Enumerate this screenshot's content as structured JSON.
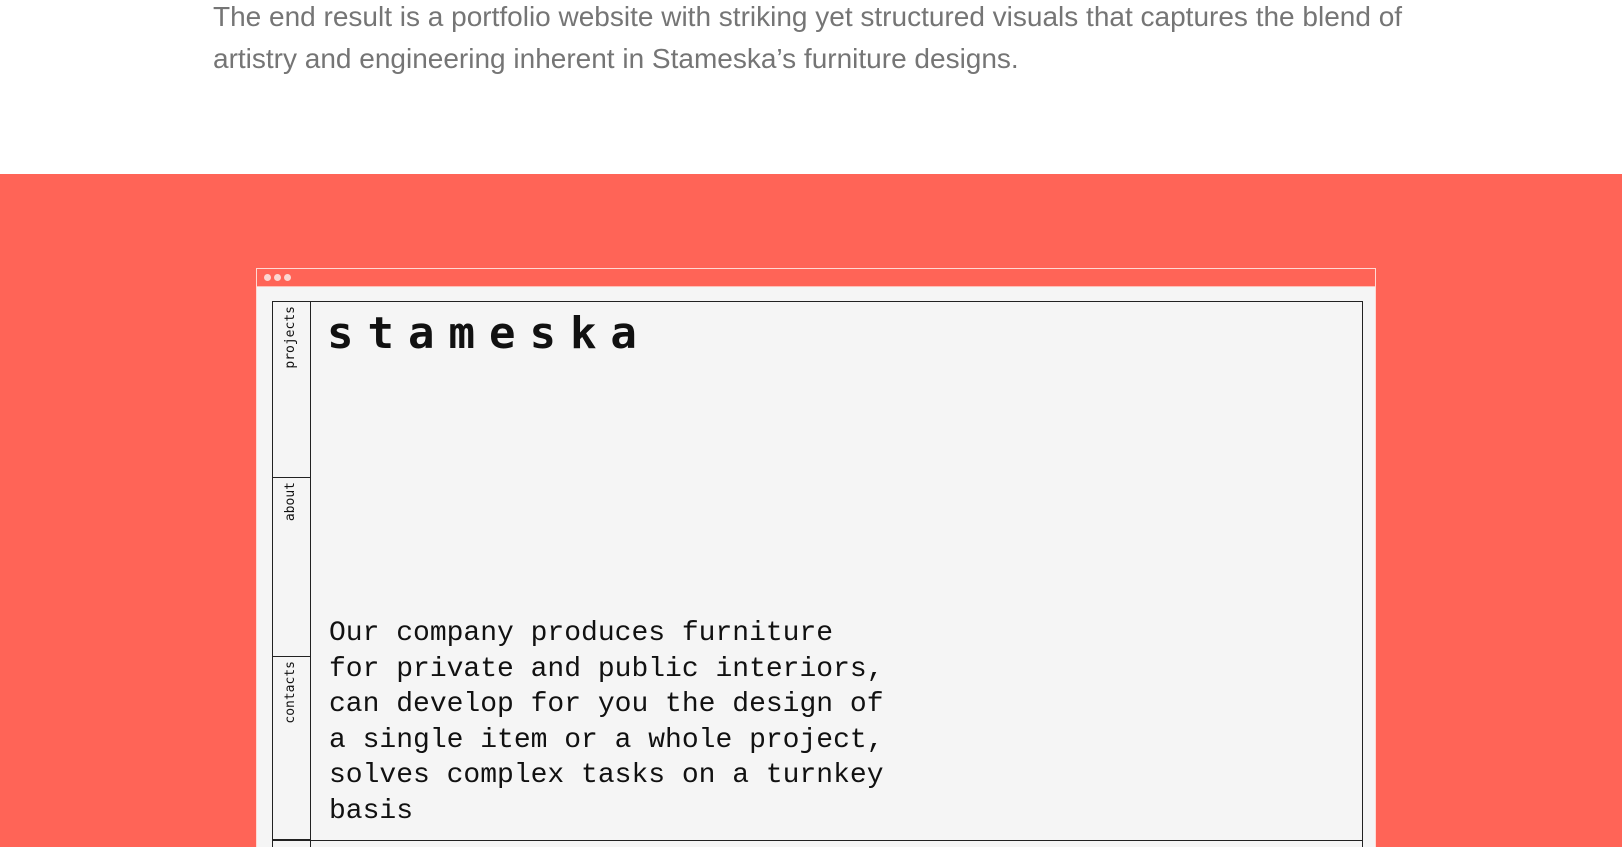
{
  "intro": {
    "text": "The end result is a portfolio website with striking yet structured visuals that captures the blend of artistry and engineering inherent in Stameska’s furniture designs."
  },
  "showcase": {
    "background_color": "#ff6457",
    "browser": {
      "site": {
        "logo": "stameska",
        "nav": [
          {
            "label": "projects"
          },
          {
            "label": "about"
          },
          {
            "label": "contacts"
          }
        ],
        "description": "Our company produces furniture\nfor private and public interiors,\ncan develop for you the design of\na single item or a whole project,\nsolves complex tasks on a turnkey\nbasis"
      }
    }
  }
}
